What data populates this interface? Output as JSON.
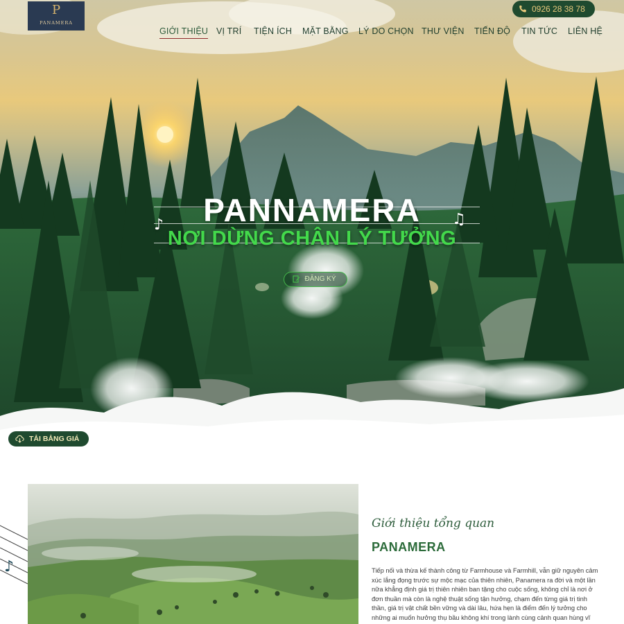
{
  "brand": {
    "logo_mark": "P",
    "logo_text": "PANAMERA"
  },
  "nav": {
    "items": [
      "GIỚI THIỆU",
      "VỊ TRÍ",
      "TIỆN ÍCH",
      "MẶT BẰNG",
      "LÝ DO CHỌN",
      "THƯ VIỆN",
      "TIẾN ĐỘ",
      "TIN TỨC",
      "LIÊN HỆ"
    ],
    "active_index": 0
  },
  "phone": {
    "number": "0926 28 38 78",
    "icon": "phone-icon"
  },
  "hero": {
    "title": "PANNAMERA",
    "subtitle": "NƠI DỪNG CHÂN LÝ TƯỞNG",
    "register_label": "ĐĂNG KÝ",
    "register_icon": "edit-icon",
    "note_icons": [
      "music-note-icon",
      "music-note-icon"
    ]
  },
  "download": {
    "label": "TẢI BẢNG GIÁ",
    "icon": "cloud-download-icon"
  },
  "about": {
    "kicker": "Giới thiệu tổng quan",
    "title": "PANAMERA",
    "body": "Tiếp nối và thừa kế thành công từ Farmhouse và Farmhill, vẫn giữ nguyên cảm xúc lắng đọng trước sự mộc mạc của thiên nhiên, Panamera ra đời và một lần nữa khẳng định giá trị thiên nhiên ban tặng cho cuộc sống, không chỉ là nơi ở đơn thuần mà còn là nghệ thuật sống tận hưởng, chạm đến từng giá trị tinh thần, giá trị vật chất bền vững và dài lâu, hứa hẹn là điểm đến lý tưởng cho những ai muốn hưởng thụ bầu không khí trong lành cùng cảnh quan hùng vĩ"
  },
  "colors": {
    "primary_green": "#1f4a2f",
    "accent_green": "#43d94b",
    "gold": "#e9c97c",
    "nav_active_underline": "#8e2b2b"
  }
}
